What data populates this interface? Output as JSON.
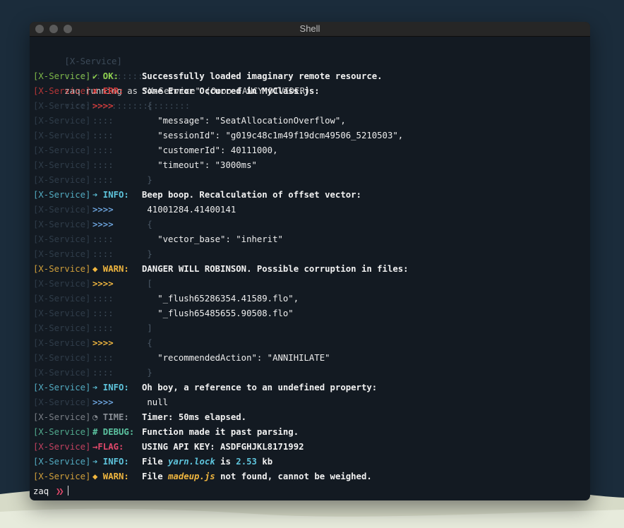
{
  "window": {
    "title": "Shell"
  },
  "colors": {
    "ok": "#8fd14f",
    "err": "#d33b3b",
    "info": "#5ec4dc",
    "warn": "#f0b63f",
    "time": "#8a8f96",
    "debug": "#5cc3a0",
    "flag": "#e0486a",
    "pipe_info": "#6aa0d8"
  },
  "divider": {
    "service": "[X-Service]",
    "colons_left": "::::::::::::::::::::::::",
    "text": "zaq running as \"X-Service\" (Oooo FANCY DIVIDER)",
    "colons_right": "::::::::::::::::::::::::"
  },
  "lines": [
    {
      "service": "[X-Service]",
      "level": "✔ OK:",
      "color": "#8fd14f",
      "message": "Successfully loaded imaginary remote resource.",
      "kind": "msg"
    },
    {
      "service": "[X-Service]",
      "level": "✘ ERR:",
      "color": "#d33b3b",
      "message": "Some Error Occurred in MyClass.js:",
      "kind": "msg"
    },
    {
      "service": "[X-Service]",
      "level": ">>>>",
      "color": "#d33b3b",
      "message": " {",
      "kind": "cont"
    },
    {
      "service": "[X-Service]",
      "level": "::::",
      "color": "",
      "message": "   \"message\": \"SeatAllocationOverflow\",",
      "kind": "body"
    },
    {
      "service": "[X-Service]",
      "level": "::::",
      "color": "",
      "message": "   \"sessionId\": \"g019c48c1m49f19dcm49506_5210503\",",
      "kind": "body"
    },
    {
      "service": "[X-Service]",
      "level": "::::",
      "color": "",
      "message": "   \"customerId\": 40111000,",
      "kind": "body"
    },
    {
      "service": "[X-Service]",
      "level": "::::",
      "color": "",
      "message": "   \"timeout\": \"3000ms\"",
      "kind": "body"
    },
    {
      "service": "[X-Service]",
      "level": "::::",
      "color": "",
      "message": " }",
      "kind": "close"
    },
    {
      "service": "[X-Service]",
      "level": "➔ INFO:",
      "color": "#5ec4dc",
      "message": "Beep boop. Recalculation of offset vector:",
      "kind": "msg"
    },
    {
      "service": "[X-Service]",
      "level": ">>>>",
      "color": "#6aa0d8",
      "message": " 41001284.41400141",
      "kind": "body"
    },
    {
      "service": "[X-Service]",
      "level": ">>>>",
      "color": "#6aa0d8",
      "message": " {",
      "kind": "cont"
    },
    {
      "service": "[X-Service]",
      "level": "::::",
      "color": "",
      "message": "   \"vector_base\": \"inherit\"",
      "kind": "body"
    },
    {
      "service": "[X-Service]",
      "level": "::::",
      "color": "",
      "message": " }",
      "kind": "close"
    },
    {
      "service": "[X-Service]",
      "level": "◆ WARN:",
      "color": "#f0b63f",
      "message": "DANGER WILL ROBINSON. Possible corruption in files:",
      "kind": "msg"
    },
    {
      "service": "[X-Service]",
      "level": ">>>>",
      "color": "#f0b63f",
      "message": " [",
      "kind": "cont"
    },
    {
      "service": "[X-Service]",
      "level": "::::",
      "color": "",
      "message": "   \"_flush65286354.41589.flo\",",
      "kind": "body"
    },
    {
      "service": "[X-Service]",
      "level": "::::",
      "color": "",
      "message": "   \"_flush65485655.90508.flo\"",
      "kind": "body"
    },
    {
      "service": "[X-Service]",
      "level": "::::",
      "color": "",
      "message": " ]",
      "kind": "close"
    },
    {
      "service": "[X-Service]",
      "level": ">>>>",
      "color": "#f0b63f",
      "message": " {",
      "kind": "cont"
    },
    {
      "service": "[X-Service]",
      "level": "::::",
      "color": "",
      "message": "   \"recommendedAction\": \"ANNIHILATE\"",
      "kind": "body"
    },
    {
      "service": "[X-Service]",
      "level": "::::",
      "color": "",
      "message": " }",
      "kind": "close"
    },
    {
      "service": "[X-Service]",
      "level": "➔ INFO:",
      "color": "#5ec4dc",
      "message": "Oh boy, a reference to an undefined property:",
      "kind": "msg"
    },
    {
      "service": "[X-Service]",
      "level": ">>>>",
      "color": "#6aa0d8",
      "message": " null",
      "kind": "body"
    },
    {
      "service": "[X-Service]",
      "level": "◔ TIME:",
      "color": "#8a8f96",
      "message": "Timer: 50ms elapsed.",
      "kind": "msg"
    },
    {
      "service": "[X-Service]",
      "level": "# DEBUG:",
      "color": "#5cc3a0",
      "message": "Function made it past parsing.",
      "kind": "msg"
    },
    {
      "service": "[X-Service]",
      "level": "→FLAG:",
      "color": "#e0486a",
      "message": "USING API KEY: ASDFGHJKL8171992",
      "kind": "msg"
    },
    {
      "service": "[X-Service]",
      "level": "➔ INFO:",
      "color": "#5ec4dc",
      "message": "",
      "kind": "rich",
      "parts": [
        {
          "t": "File ",
          "c": ""
        },
        {
          "t": "yarn.lock",
          "c": "#5ec4dc",
          "f": "file"
        },
        {
          "t": " is ",
          "c": ""
        },
        {
          "t": "2.53",
          "c": "#5ec4dc"
        },
        {
          "t": " kb",
          "c": ""
        }
      ]
    },
    {
      "service": "[X-Service]",
      "level": "◆ WARN:",
      "color": "#f0b63f",
      "message": "",
      "kind": "rich",
      "parts": [
        {
          "t": "File ",
          "c": ""
        },
        {
          "t": "madeup.js",
          "c": "#f0b63f",
          "f": "file"
        },
        {
          "t": " not found, cannot be weighed.",
          "c": ""
        }
      ]
    }
  ],
  "prompt": {
    "user": "zaq",
    "chevrons": "❯❯"
  }
}
